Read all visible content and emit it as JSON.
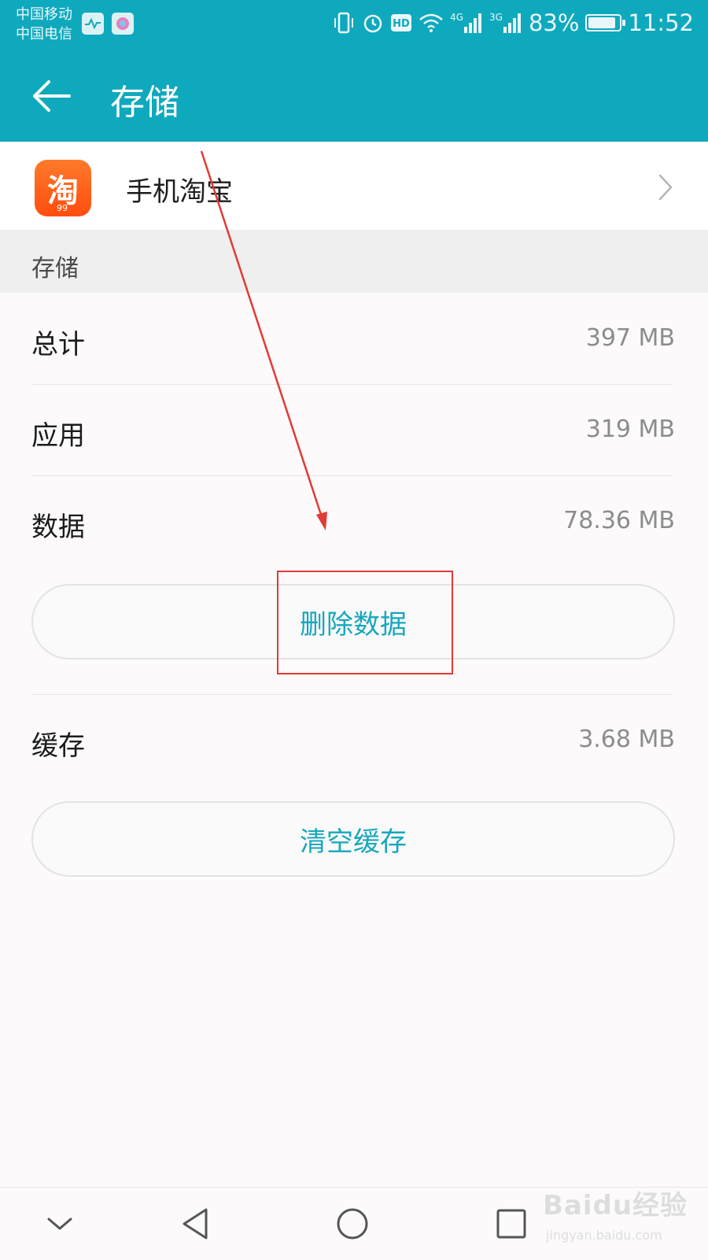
{
  "status_bar": {
    "carrier_1": "中国移动",
    "carrier_2": "中国电信",
    "network_1": "4G",
    "network_2": "3G",
    "battery": "83%",
    "time": "11:52",
    "icons": [
      "pulse-app-icon",
      "color-app-icon",
      "vibrate-icon",
      "alarm-icon",
      "hd-icon",
      "wifi-icon",
      "signal-icon",
      "signal-icon",
      "battery-icon"
    ]
  },
  "app_bar": {
    "title": "存储",
    "back_icon": "arrow-left-icon"
  },
  "app_row": {
    "name": "手机淘宝",
    "icon_glyph": "淘",
    "icon_badge": "99",
    "chevron_icon": "chevron-right-icon"
  },
  "section": {
    "header": "存储"
  },
  "rows": {
    "total": {
      "label": "总计",
      "value": "397 MB"
    },
    "app": {
      "label": "应用",
      "value": "319 MB"
    },
    "data": {
      "label": "数据",
      "value": "78.36 MB"
    },
    "cache": {
      "label": "缓存",
      "value": "3.68 MB"
    }
  },
  "buttons": {
    "clear_data": "删除数据",
    "clear_cache": "清空缓存"
  },
  "nav_bar": {
    "icons": [
      "chevron-down-icon",
      "back-triangle-icon",
      "home-circle-icon",
      "recents-square-icon"
    ]
  },
  "watermark": {
    "text": "Baidu经验",
    "url": "jingyan.baidu.com"
  },
  "colors": {
    "accent": "#0fa9be",
    "button_text": "#16a7bd",
    "annotation": "#e23a35"
  }
}
